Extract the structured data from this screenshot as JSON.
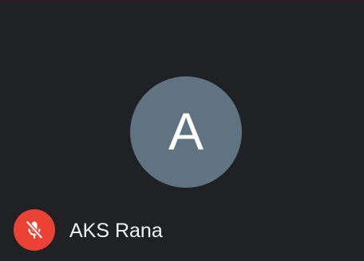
{
  "participant": {
    "initial": "A",
    "name": "AKS Rana",
    "avatar_color": "#5f7480",
    "muted": true,
    "mic_status_icon": "mic-off-icon",
    "mic_badge_color": "#ea4335"
  },
  "colors": {
    "background": "#202124",
    "text": "#f1f3f4"
  }
}
